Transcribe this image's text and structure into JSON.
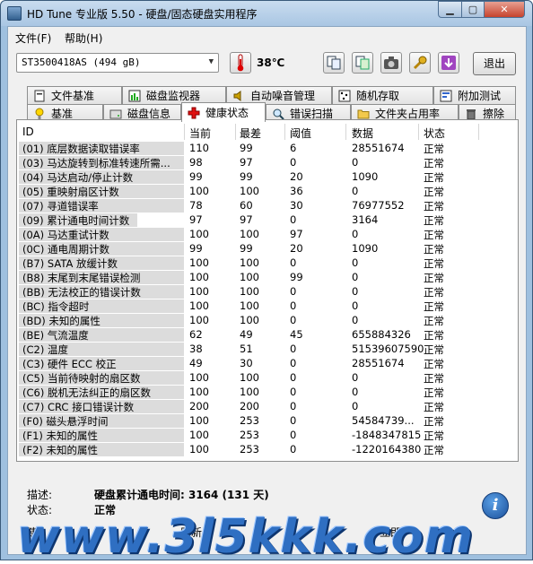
{
  "window": {
    "title": "HD Tune 专业版 5.50 - 硬盘/固态硬盘实用程序"
  },
  "menu": {
    "items": [
      "文件(F)",
      "帮助(H)"
    ]
  },
  "toolbar": {
    "drive": "ST3500418AS (494 gB)",
    "temperature": "38℃",
    "exit_label": "退出",
    "icons": [
      "thermometer-icon",
      "copy-info-icon",
      "copy-data-icon",
      "screenshot-icon",
      "options-icon",
      "save-icon"
    ]
  },
  "tabs_top": [
    {
      "label": "文件基准",
      "icon": "file-bench-icon"
    },
    {
      "label": "磁盘监视器",
      "icon": "disk-monitor-icon"
    },
    {
      "label": "自动噪音管理",
      "icon": "speaker-icon"
    },
    {
      "label": "随机存取",
      "icon": "random-access-icon"
    },
    {
      "label": "附加测试",
      "icon": "extra-tests-icon"
    }
  ],
  "tabs_bottom": [
    {
      "label": "基准",
      "icon": "benchmark-icon"
    },
    {
      "label": "磁盘信息",
      "icon": "disk-info-icon"
    },
    {
      "label": "健康状态",
      "icon": "health-cross-icon",
      "active": true
    },
    {
      "label": "错误扫描",
      "icon": "error-scan-icon"
    },
    {
      "label": "文件夹占用率",
      "icon": "folder-icon"
    },
    {
      "label": "擦除",
      "icon": "trash-icon"
    }
  ],
  "grid": {
    "headers": [
      "ID",
      "当前",
      "最差",
      "阈值",
      "数据",
      "状态"
    ],
    "rows": [
      [
        "(01) 底层数据读取错误率",
        "110",
        "99",
        "6",
        "28551674",
        "正常"
      ],
      [
        "(03) 马达旋转到标准转速所需...",
        "98",
        "97",
        "0",
        "0",
        "正常"
      ],
      [
        "(04) 马达启动/停止计数",
        "99",
        "99",
        "20",
        "1090",
        "正常"
      ],
      [
        "(05) 重映射扇区计数",
        "100",
        "100",
        "36",
        "0",
        "正常"
      ],
      [
        "(07) 寻道错误率",
        "78",
        "60",
        "30",
        "76977552",
        "正常"
      ],
      [
        "(09) 累计通电时间计数",
        "97",
        "97",
        "0",
        "3164",
        "正常"
      ],
      [
        "(0A) 马达重试计数",
        "100",
        "100",
        "97",
        "0",
        "正常"
      ],
      [
        "(0C) 通电周期计数",
        "99",
        "99",
        "20",
        "1090",
        "正常"
      ],
      [
        "(B7) SATA 放缓计数",
        "100",
        "100",
        "0",
        "0",
        "正常"
      ],
      [
        "(B8) 末尾到末尾错误检测",
        "100",
        "100",
        "99",
        "0",
        "正常"
      ],
      [
        "(BB) 无法校正的错误计数",
        "100",
        "100",
        "0",
        "0",
        "正常"
      ],
      [
        "(BC) 指令超时",
        "100",
        "100",
        "0",
        "0",
        "正常"
      ],
      [
        "(BD) 未知的属性",
        "100",
        "100",
        "0",
        "0",
        "正常"
      ],
      [
        "(BE) 气流温度",
        "62",
        "49",
        "45",
        "655884326",
        "正常"
      ],
      [
        "(C2) 温度",
        "38",
        "51",
        "0",
        "51539607590",
        "正常"
      ],
      [
        "(C3) 硬件 ECC 校正",
        "49",
        "30",
        "0",
        "28551674",
        "正常"
      ],
      [
        "(C5) 当前待映射的扇区数",
        "100",
        "100",
        "0",
        "0",
        "正常"
      ],
      [
        "(C6) 脱机无法纠正的扇区数",
        "100",
        "100",
        "0",
        "0",
        "正常"
      ],
      [
        "(C7) CRC 接口错误计数",
        "200",
        "200",
        "0",
        "0",
        "正常"
      ],
      [
        "(F0) 磁头悬浮时间",
        "100",
        "253",
        "0",
        "54584739...",
        "正常"
      ],
      [
        "(F1) 未知的属性",
        "100",
        "253",
        "0",
        "-1848347815",
        "正常"
      ],
      [
        "(F2) 未知的属性",
        "100",
        "253",
        "0",
        "-1220164380",
        "正常"
      ]
    ]
  },
  "footer": {
    "desc_label": "描述:",
    "desc_value": "硬盘累计通电时间: 3164 (131 天)",
    "status_label": "状态:",
    "status_value": "正常",
    "left_button": "健",
    "refresh_button": "刷新",
    "update_button": "立即"
  },
  "watermark": "www.3l5kkk.com"
}
